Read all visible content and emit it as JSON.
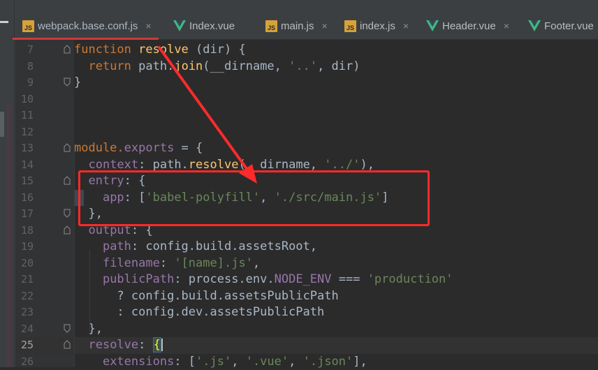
{
  "tabs": [
    {
      "label": "webpack.base.conf.js",
      "icon": "js-file-icon",
      "active": true,
      "closable": true
    },
    {
      "label": "Index.vue",
      "icon": "vue-file-icon",
      "active": false,
      "closable": false
    },
    {
      "label": "main.js",
      "icon": "js-file-icon",
      "active": false,
      "closable": true
    },
    {
      "label": "index.js",
      "icon": "js-file-icon",
      "active": false,
      "closable": true
    },
    {
      "label": "Header.vue",
      "icon": "vue-file-icon",
      "active": false,
      "closable": true
    },
    {
      "label": "Footer.vue",
      "icon": "vue-file-icon",
      "active": false,
      "closable": false
    }
  ],
  "close_glyph": "×",
  "js_badge": "JS",
  "lines": [
    {
      "n": "7"
    },
    {
      "n": "8"
    },
    {
      "n": "9"
    },
    {
      "n": "10"
    },
    {
      "n": "11"
    },
    {
      "n": "12"
    },
    {
      "n": "13"
    },
    {
      "n": "14"
    },
    {
      "n": "15"
    },
    {
      "n": "16"
    },
    {
      "n": "17"
    },
    {
      "n": "18"
    },
    {
      "n": "19"
    },
    {
      "n": "20"
    },
    {
      "n": "21"
    },
    {
      "n": "22"
    },
    {
      "n": "23"
    },
    {
      "n": "24"
    },
    {
      "n": "25"
    },
    {
      "n": "26"
    }
  ],
  "code": {
    "l7": {
      "kw": "function",
      "name": "resolve",
      "rest": " (dir) {"
    },
    "l8": {
      "kw": "return",
      "obj": "path.",
      "fn": "join",
      "open": "(__dirname, ",
      "s1": "'..'",
      "rest": ", dir)"
    },
    "l9": {
      "text": "}"
    },
    "l13": {
      "obj": "module.",
      "prop": "exports",
      "rest": " = {"
    },
    "l14": {
      "key": "context",
      "colon": ": path.",
      "fn": "resolve",
      "open": "(__dirname, ",
      "s1": "'../'",
      "rest": "),"
    },
    "l15": {
      "key": "entry",
      "rest": ": {"
    },
    "l16": {
      "key": "app",
      "open": ": [",
      "s1": "'babel-polyfill'",
      "sep": ", ",
      "s2": "'./src/main.js'",
      "rest": "]"
    },
    "l17": {
      "text": "},"
    },
    "l18": {
      "key": "output",
      "rest": ": {"
    },
    "l19": {
      "key": "path",
      "rest": ": config.build.assetsRoot,"
    },
    "l20": {
      "key": "filename",
      "open": ": ",
      "s1": "'[name].js'",
      "rest": ","
    },
    "l21": {
      "key": "publicPath",
      "mid": ": process.env.",
      "prop": "NODE_ENV",
      "op": " === ",
      "s1": "'production'"
    },
    "l22": {
      "text": "? config.build.assetsPublicPath"
    },
    "l23": {
      "text": ": config.dev.assetsPublicPath"
    },
    "l24": {
      "text": "},"
    },
    "l25": {
      "key": "resolve",
      "colon": ": ",
      "brace": "{"
    },
    "l26": {
      "key": "extensions",
      "open": ": [",
      "s1": "'.js'",
      "sep1": ", ",
      "s2": "'.vue'",
      "sep2": ", ",
      "s3": "'.json'",
      "rest": "],"
    }
  },
  "colors": {
    "keyword": "#cc7832",
    "function": "#ffc66d",
    "property": "#9876aa",
    "string": "#6a8759",
    "annotation": "#ff2a2a"
  }
}
